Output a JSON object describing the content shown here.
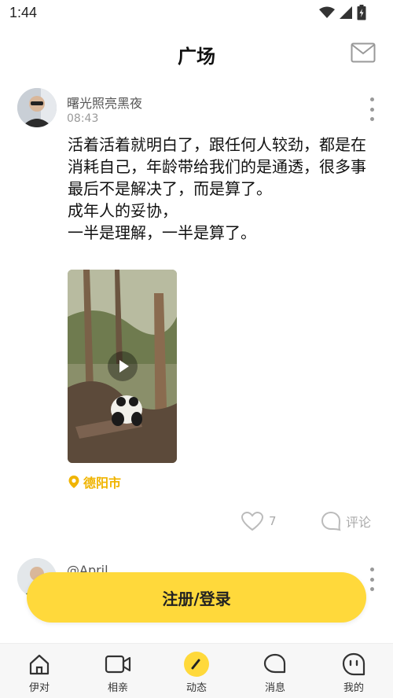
{
  "status_bar": {
    "time": "1:44"
  },
  "header": {
    "title": "广场"
  },
  "post": {
    "username": "曙光照亮黑夜",
    "time": "08:43",
    "content": "活着活着就明白了，跟任何人较劲，都是在消耗自己，年龄带给我们的是通透，很多事最后不是解决了，而是算了。\n成年人的妥协，\n一半是理解，一半是算了。",
    "location": "德阳市",
    "likes": "7",
    "comment_label": "评论"
  },
  "post2": {
    "username": "@April"
  },
  "login_button": "注册/登录",
  "tabs": [
    {
      "label": "伊对",
      "icon": "home-icon"
    },
    {
      "label": "相亲",
      "icon": "video-camera-icon"
    },
    {
      "label": "动态",
      "icon": "pen-icon"
    },
    {
      "label": "消息",
      "icon": "chat-bubble-icon"
    },
    {
      "label": "我的",
      "icon": "profile-face-icon"
    }
  ],
  "colors": {
    "accent": "#ffd93b",
    "location": "#f0b400",
    "tab_bg": "#f7f7f7"
  }
}
